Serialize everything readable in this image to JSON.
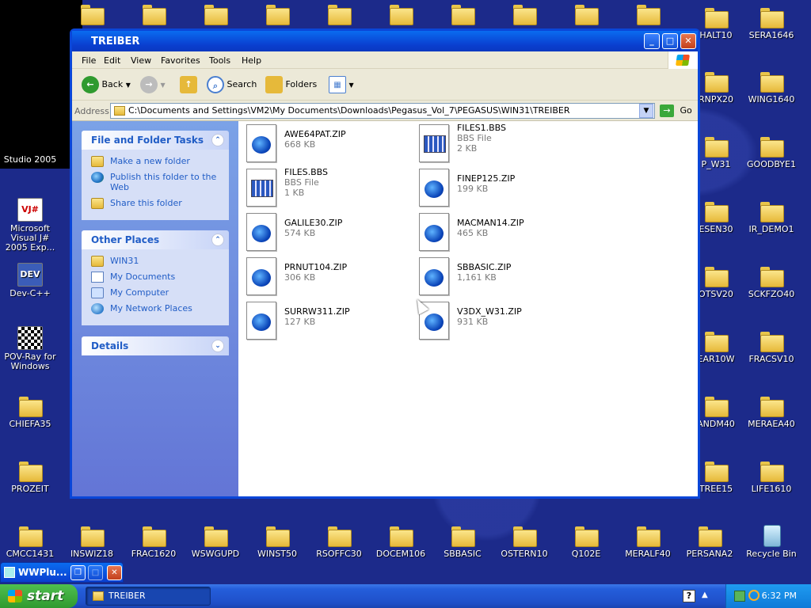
{
  "window": {
    "title": "TREIBER",
    "minimize": "_",
    "maximize": "□",
    "close": "✕"
  },
  "menubar": [
    "File",
    "Edit",
    "View",
    "Favorites",
    "Tools",
    "Help"
  ],
  "toolbar": {
    "back_label": "Back",
    "search_label": "Search",
    "folders_label": "Folders"
  },
  "address": {
    "label": "Address",
    "value": "C:\\Documents and Settings\\VM2\\My Documents\\Downloads\\Pegasus_Vol_7\\PEGASUS\\WIN31\\TREIBER",
    "go_label": "Go"
  },
  "taskpane": {
    "file_tasks": {
      "title": "File and Folder Tasks",
      "items": [
        {
          "label": "Make a new folder",
          "icon": "new-folder-icon"
        },
        {
          "label": "Publish this folder to the Web",
          "icon": "globe-icon"
        },
        {
          "label": "Share this folder",
          "icon": "share-folder-icon"
        }
      ]
    },
    "other_places": {
      "title": "Other Places",
      "items": [
        {
          "label": "WIN31",
          "icon": "folder-icon"
        },
        {
          "label": "My Documents",
          "icon": "my-documents-icon"
        },
        {
          "label": "My Computer",
          "icon": "my-computer-icon"
        },
        {
          "label": "My Network Places",
          "icon": "network-icon"
        }
      ]
    },
    "details": {
      "title": "Details"
    }
  },
  "files": [
    {
      "name": "AWE64PAT.ZIP",
      "type": "",
      "size": "668 KB",
      "kind": "zip"
    },
    {
      "name": "FILES1.BBS",
      "type": "BBS File",
      "size": "2 KB",
      "kind": "bbs"
    },
    {
      "name": "FILES.BBS",
      "type": "BBS File",
      "size": "1 KB",
      "kind": "bbs"
    },
    {
      "name": "FINEP125.ZIP",
      "type": "",
      "size": "199 KB",
      "kind": "zip"
    },
    {
      "name": "GALILE30.ZIP",
      "type": "",
      "size": "574 KB",
      "kind": "zip"
    },
    {
      "name": "MACMAN14.ZIP",
      "type": "",
      "size": "465 KB",
      "kind": "zip"
    },
    {
      "name": "PRNUT104.ZIP",
      "type": "",
      "size": "306 KB",
      "kind": "zip"
    },
    {
      "name": "SBBASIC.ZIP",
      "type": "",
      "size": "1,161 KB",
      "kind": "zip"
    },
    {
      "name": "SURRW311.ZIP",
      "type": "",
      "size": "127 KB",
      "kind": "zip"
    },
    {
      "name": "V3DX_W31.ZIP",
      "type": "",
      "size": "931 KB",
      "kind": "zip"
    }
  ],
  "desktop": {
    "left_icons": [
      "Studio 2005",
      "Microsoft Visual J# 2005 Exp...",
      "Dev-C++",
      "POV-Ray for Windows",
      "CHIEFA35",
      "PROZEIT"
    ],
    "right_col1": [
      "HALT10",
      "RNPX20",
      "P_W31",
      "ESEN30",
      "OTSV20",
      "EAR10W",
      "ANDM40",
      "TREE15"
    ],
    "right_col2": [
      "SERA1646",
      "WING1640",
      "GOODBYE1",
      "IR_DEMO1",
      "SCKFZO40",
      "FRACSV10",
      "MERAEA40",
      "LIFE1610"
    ],
    "bottom_row": [
      "CMCC1431",
      "INSWIZ18",
      "FRAC1620",
      "WSWGUPD",
      "WINST50",
      "RSOFFC30",
      "DOCEM106",
      "SBBASIC",
      "OSTERN10",
      "Q102E",
      "MERALF40",
      "PERSANA2",
      "Recycle Bin"
    ],
    "app_icon_labels": {
      "vj": "VJ#",
      "dev": "DEV"
    }
  },
  "mini_window": {
    "title": "WWPlu..."
  },
  "taskbar": {
    "start_label": "start",
    "task_item": "TREIBER",
    "help_glyph": "?",
    "clock": "6:32 PM"
  }
}
